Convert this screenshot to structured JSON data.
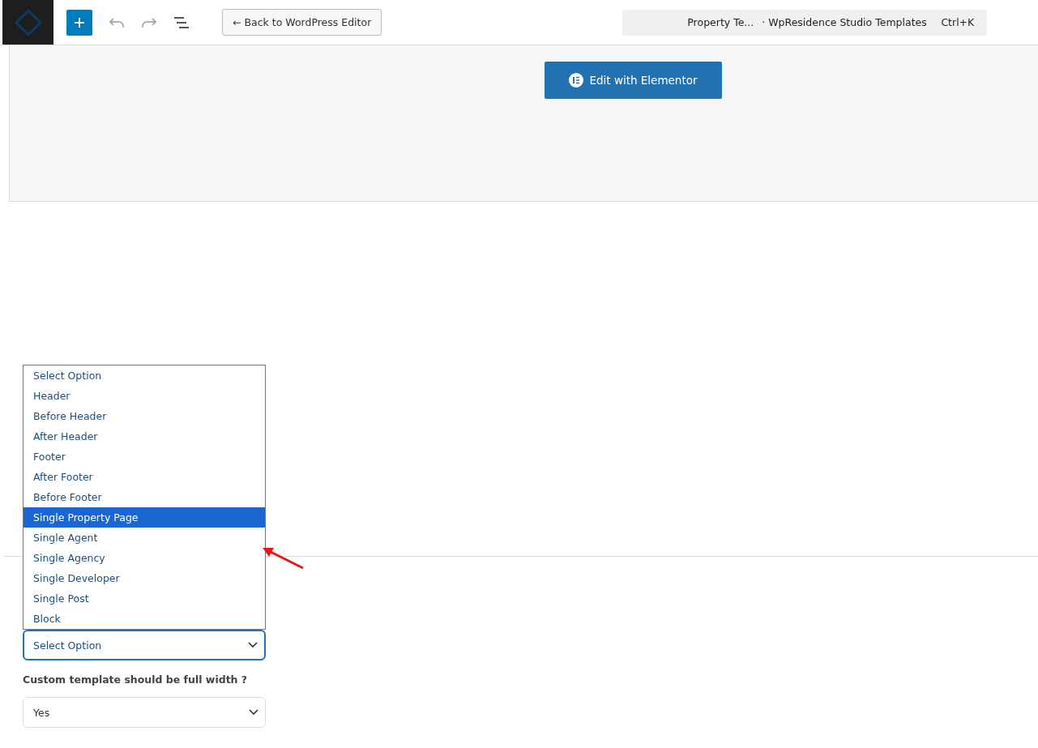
{
  "toolbar": {
    "back_button": "← Back to WordPress Editor",
    "document_title": "Property Te...",
    "site_title": "· WpResidence Studio Templates",
    "shortcut": "Ctrl+K"
  },
  "canvas": {
    "edit_button": "Edit with Elementor"
  },
  "template_select": {
    "value": "Select Option",
    "expanded": true,
    "options": [
      {
        "label": "Select Option",
        "highlighted": false
      },
      {
        "label": "Header",
        "highlighted": false
      },
      {
        "label": "Before Header",
        "highlighted": false
      },
      {
        "label": "After Header",
        "highlighted": false
      },
      {
        "label": "Footer",
        "highlighted": false
      },
      {
        "label": "After Footer",
        "highlighted": false
      },
      {
        "label": "Before Footer",
        "highlighted": false
      },
      {
        "label": "Single Property Page",
        "highlighted": true
      },
      {
        "label": "Single Agent",
        "highlighted": false
      },
      {
        "label": "Single Agency",
        "highlighted": false
      },
      {
        "label": "Single Developer",
        "highlighted": false
      },
      {
        "label": "Single Post",
        "highlighted": false
      },
      {
        "label": "Block",
        "highlighted": false
      }
    ]
  },
  "full_width": {
    "label": "Custom template should be full width ?",
    "value": "Yes"
  }
}
